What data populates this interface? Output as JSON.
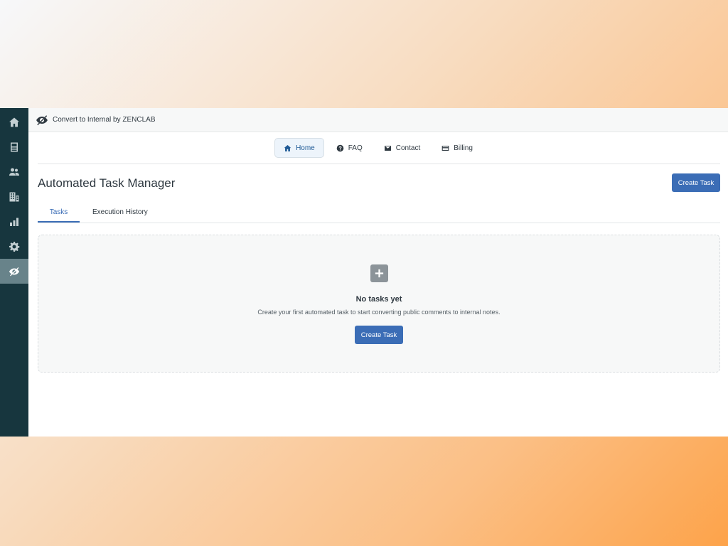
{
  "app": {
    "title": "Convert to Internal by ZENCLAB",
    "logo_icon": "eye-slash-icon"
  },
  "sidebar": {
    "items": [
      {
        "name": "home",
        "icon": "home-icon"
      },
      {
        "name": "inbox",
        "icon": "inbox-icon"
      },
      {
        "name": "users",
        "icon": "users-icon"
      },
      {
        "name": "organizations",
        "icon": "building-icon"
      },
      {
        "name": "reports",
        "icon": "bar-chart-icon"
      },
      {
        "name": "settings",
        "icon": "gear-icon"
      },
      {
        "name": "convert-to-internal",
        "icon": "eye-slash-icon",
        "active": true
      }
    ]
  },
  "nav": {
    "items": [
      {
        "label": "Home",
        "icon": "home-icon",
        "active": true
      },
      {
        "label": "FAQ",
        "icon": "question-circle-icon"
      },
      {
        "label": "Contact",
        "icon": "envelope-icon"
      },
      {
        "label": "Billing",
        "icon": "credit-card-icon"
      }
    ]
  },
  "page": {
    "title": "Automated Task Manager",
    "create_button": "Create Task"
  },
  "tabs": [
    {
      "label": "Tasks",
      "active": true
    },
    {
      "label": "Execution History"
    }
  ],
  "empty_state": {
    "icon": "plus-square-icon",
    "title": "No tasks yet",
    "description": "Create your first automated task to start converting public comments to internal notes.",
    "button": "Create Task"
  },
  "colors": {
    "sidebar_bg": "#17363e",
    "sidebar_active": "#68838a",
    "primary": "#3b6db6",
    "nav_active_text": "#1f5a96"
  }
}
